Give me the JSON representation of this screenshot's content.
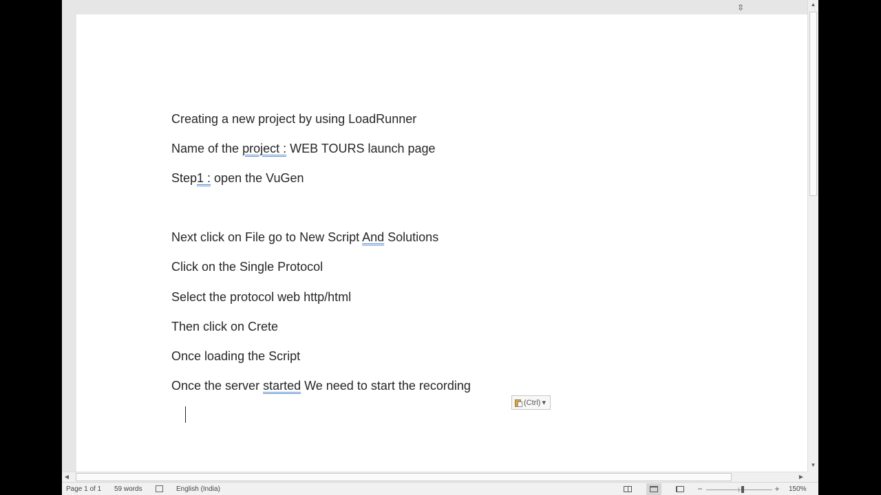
{
  "document": {
    "paragraphs": [
      {
        "segments": [
          {
            "text": "Creating a new project by using LoadRunner",
            "flag": false
          }
        ]
      },
      {
        "segments": [
          {
            "text": "Name of the ",
            "flag": false
          },
          {
            "text": "project :",
            "flag": true
          },
          {
            "text": " WEB TOURS launch page",
            "flag": false
          }
        ]
      },
      {
        "segments": [
          {
            "text": "Step",
            "flag": false
          },
          {
            "text": "1 :",
            "flag": true
          },
          {
            "text": " open the VuGen",
            "flag": false
          }
        ]
      },
      {
        "segments": [
          {
            "text": "Next click on File go to New Script ",
            "flag": false
          },
          {
            "text": "And",
            "flag": true
          },
          {
            "text": " Solutions",
            "flag": false
          }
        ]
      },
      {
        "segments": [
          {
            "text": "Click on the Single Protocol",
            "flag": false
          }
        ]
      },
      {
        "segments": [
          {
            "text": "Select the protocol web http/html",
            "flag": false
          }
        ]
      },
      {
        "segments": [
          {
            "text": "Then click on Crete",
            "flag": false
          }
        ]
      },
      {
        "segments": [
          {
            "text": "Once loading the Script",
            "flag": false
          }
        ]
      },
      {
        "segments": [
          {
            "text": "Once the server ",
            "flag": false
          },
          {
            "text": "started",
            "flag": true
          },
          {
            "text": " We need to start the recording",
            "flag": false
          }
        ]
      }
    ]
  },
  "paste_options": {
    "label": "(Ctrl)",
    "arrow": "▾",
    "icon": "clipboard-icon"
  },
  "scrollbars": {
    "up": "▲",
    "down": "▼",
    "left": "◀",
    "right": "▶"
  },
  "status_bar": {
    "page": "Page 1 of 1",
    "words": "59 words",
    "language": "English (India)",
    "zoom_minus": "−",
    "zoom_plus": "+",
    "zoom_label": "150%",
    "zoom_percent": 150,
    "view_modes": [
      "read-mode",
      "print-layout",
      "web-layout"
    ],
    "active_view": "print-layout"
  },
  "colors": {
    "squiggle": "#5b8fd1",
    "text": "#262626"
  }
}
